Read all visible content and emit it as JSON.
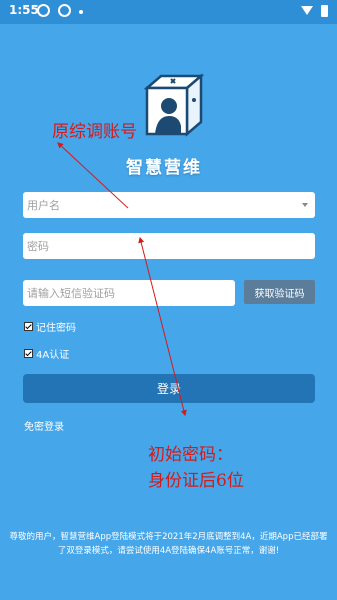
{
  "status_bar": {
    "time": "1:55"
  },
  "app": {
    "title": "智慧营维"
  },
  "form": {
    "username_placeholder": "用户名",
    "password_placeholder": "密码",
    "sms_placeholder": "请输入短信验证码",
    "sms_button": "获取验证码",
    "remember_password": "记住密码",
    "auth_4a": "4A认证",
    "login_button": "登录",
    "no_password_login": "免密登录"
  },
  "notice": "尊敬的用户，智慧营维App登陆模式将于2021年2月底调整到4A，近期App已经部署了双登录模式，请尝试使用4A登陆确保4A账号正常，谢谢!",
  "annotations": {
    "original_account": "原综调账号",
    "initial_password_line1": "初始密码：",
    "initial_password_line2": "身份证后6位"
  },
  "colors": {
    "background": "#45a6ea",
    "login_button": "#2274b5",
    "annotation": "#d41b1b"
  }
}
